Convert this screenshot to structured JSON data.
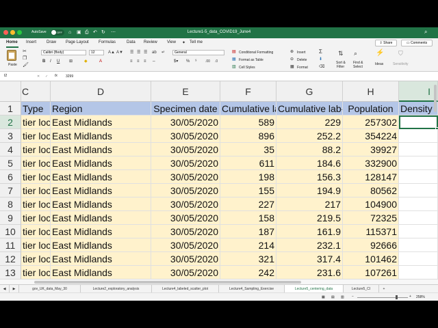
{
  "titlebar": {
    "autosave_label": "AutoSave",
    "autosave_state": "OFF",
    "document_title": "Lecture1-5_data_COVID19_June4"
  },
  "ribbon_tabs": [
    "Home",
    "Insert",
    "Draw",
    "Page Layout",
    "Formulas",
    "Data",
    "Review",
    "View"
  ],
  "tell_me": "Tell me",
  "share_label": "Share",
  "comments_label": "Comments",
  "ribbon": {
    "paste_label": "Paste",
    "font_name": "Calibri (Body)",
    "font_size": "12",
    "number_format": "General",
    "conditional_formatting": "Conditional Formatting",
    "format_as_table": "Format as Table",
    "cell_styles": "Cell Styles",
    "insert": "Insert",
    "delete": "Delete",
    "format": "Format",
    "sort_filter": "Sort &\nFilter",
    "sort_filter_l1": "Sort &",
    "sort_filter_l2": "Filter",
    "find_select_l1": "Find &",
    "find_select_l2": "Select",
    "ideas": "Ideas",
    "sensitivity": "Sensitivity"
  },
  "formula_bar": {
    "name_box": "I2",
    "fx": "fx",
    "value": "3299"
  },
  "columns": [
    "C",
    "D",
    "E",
    "F",
    "G",
    "H",
    "I"
  ],
  "selected_column": "I",
  "header_row": {
    "row": "1",
    "cells": [
      "Type",
      "Region",
      "Specimen date",
      "Cumulative lab",
      "Cumulative lab-",
      "Population",
      "Density"
    ]
  },
  "rows": [
    {
      "row": "2",
      "cells": [
        "tier local",
        "East Midlands",
        "30/05/2020",
        "589",
        "229",
        "257302",
        ""
      ]
    },
    {
      "row": "3",
      "cells": [
        "tier local",
        "East Midlands",
        "30/05/2020",
        "896",
        "252.2",
        "354224",
        ""
      ]
    },
    {
      "row": "4",
      "cells": [
        "tier local",
        "East Midlands",
        "30/05/2020",
        "35",
        "88.2",
        "39927",
        ""
      ]
    },
    {
      "row": "5",
      "cells": [
        "tier local",
        "East Midlands",
        "30/05/2020",
        "611",
        "184.6",
        "332900",
        ""
      ]
    },
    {
      "row": "6",
      "cells": [
        "tier local",
        "East Midlands",
        "30/05/2020",
        "198",
        "156.3",
        "128147",
        ""
      ]
    },
    {
      "row": "7",
      "cells": [
        "tier local",
        "East Midlands",
        "30/05/2020",
        "155",
        "194.9",
        "80562",
        ""
      ]
    },
    {
      "row": "8",
      "cells": [
        "tier local",
        "East Midlands",
        "30/05/2020",
        "227",
        "217",
        "104900",
        ""
      ]
    },
    {
      "row": "9",
      "cells": [
        "tier local",
        "East Midlands",
        "30/05/2020",
        "158",
        "219.5",
        "72325",
        ""
      ]
    },
    {
      "row": "10",
      "cells": [
        "tier local",
        "East Midlands",
        "30/05/2020",
        "187",
        "161.9",
        "115371",
        ""
      ]
    },
    {
      "row": "11",
      "cells": [
        "tier local",
        "East Midlands",
        "30/05/2020",
        "214",
        "232.1",
        "92666",
        ""
      ]
    },
    {
      "row": "12",
      "cells": [
        "tier local",
        "East Midlands",
        "30/05/2020",
        "321",
        "317.4",
        "101462",
        ""
      ]
    },
    {
      "row": "13",
      "cells": [
        "tier local",
        "East Midlands",
        "30/05/2020",
        "242",
        "231.6",
        "107261",
        ""
      ]
    }
  ],
  "sheet_tabs": [
    "gov_UK_data_May_30",
    "Lecture2_exploratory_analysis",
    "Lecture4_labeled_scatter_plot",
    "Lecture4_Sampling_Exercise",
    "Lecture5_centering_data",
    "Lecture5_CI"
  ],
  "active_sheet": "Lecture5_centering_data",
  "zoom": "258%",
  "colors": {
    "excel_green": "#217346",
    "header_fill": "#b4c6e7",
    "data_fill": "#fff2cc"
  }
}
